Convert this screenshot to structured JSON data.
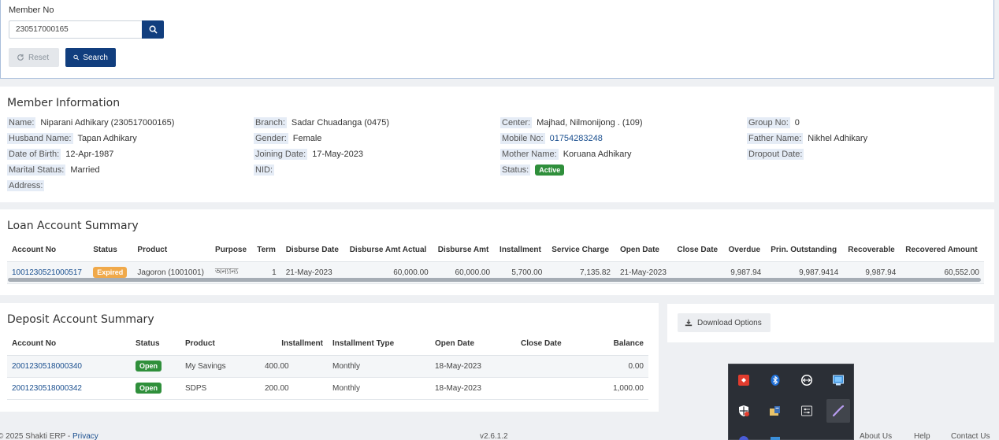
{
  "search": {
    "label": "Member No",
    "value": "230517000165",
    "reset_label": "Reset",
    "search_label": "Search"
  },
  "member": {
    "title": "Member Information",
    "name_k": "Name:",
    "name_v": "Niparani Adhikary (230517000165)",
    "husband_k": "Husband Name:",
    "husband_v": "Tapan Adhikary",
    "dob_k": "Date of Birth:",
    "dob_v": "12-Apr-1987",
    "marital_k": "Marital Status:",
    "marital_v": "Married",
    "address_k": "Address:",
    "branch_k": "Branch:",
    "branch_v": "Sadar Chuadanga (0475)",
    "gender_k": "Gender:",
    "gender_v": "Female",
    "joining_k": "Joining Date:",
    "joining_v": "17-May-2023",
    "nid_k": "NID:",
    "center_k": "Center:",
    "center_v": "Majhad, Nilmonijong . (109)",
    "mobile_k": "Mobile No:",
    "mobile_v": "01754283248",
    "mother_k": "Mother Name:",
    "mother_v": "Koruana Adhikary",
    "status_k": "Status:",
    "status_v": "Active",
    "group_k": "Group No:",
    "group_v": "0",
    "father_k": "Father Name:",
    "father_v": "Nikhel Adhikary",
    "dropout_k": "Dropout Date:"
  },
  "loan": {
    "title": "Loan Account Summary",
    "headers": [
      "Account No",
      "Status",
      "Product",
      "Purpose",
      "Term",
      "Disburse Date",
      "Disburse Amt Actual",
      "Disburse Amt",
      "Installment",
      "Service Charge",
      "Open Date",
      "Close Date",
      "Overdue",
      "Prin. Outstanding",
      "Recoverable",
      "Recovered Amount"
    ],
    "row": {
      "account": "1001230521000517",
      "status": "Expired",
      "product": "Jagoron (1001001)",
      "purpose": "অন্যান্য",
      "term": "1",
      "disburse_date": "21-May-2023",
      "amt_actual": "60,000.00",
      "amt": "60,000.00",
      "installment": "5,700.00",
      "service_charge": "7,135.82",
      "open_date": "21-May-2023",
      "close_date": "",
      "overdue": "9,987.94",
      "prin_outstanding": "9,987.9414",
      "recoverable": "9,987.94",
      "recovered": "60,552.00"
    }
  },
  "deposit": {
    "title": "Deposit Account Summary",
    "headers": [
      "Account No",
      "Status",
      "Product",
      "Installment",
      "Installment Type",
      "Open Date",
      "Close Date",
      "Balance"
    ],
    "rows": [
      {
        "account": "2001230518000340",
        "status": "Open",
        "product": "My Savings",
        "installment": "400.00",
        "type": "Monthly",
        "open_date": "18-May-2023",
        "close_date": "",
        "balance": "0.00"
      },
      {
        "account": "2001230518000342",
        "status": "Open",
        "product": "SDPS",
        "installment": "200.00",
        "type": "Monthly",
        "open_date": "18-May-2023",
        "close_date": "",
        "balance": "1,000.00"
      }
    ]
  },
  "download_label": "Download Options",
  "footer": {
    "copyright": "© 2025 Shakti ERP - ",
    "privacy": "Privacy",
    "version": "v2.6.1.2",
    "about": "About Us",
    "help": "Help",
    "contact": "Contact Us"
  },
  "colors": {
    "primary": "#113e7e",
    "active_badge": "#2f8f3b",
    "expired_badge": "#f0a94a",
    "link": "#1a4f8f"
  }
}
